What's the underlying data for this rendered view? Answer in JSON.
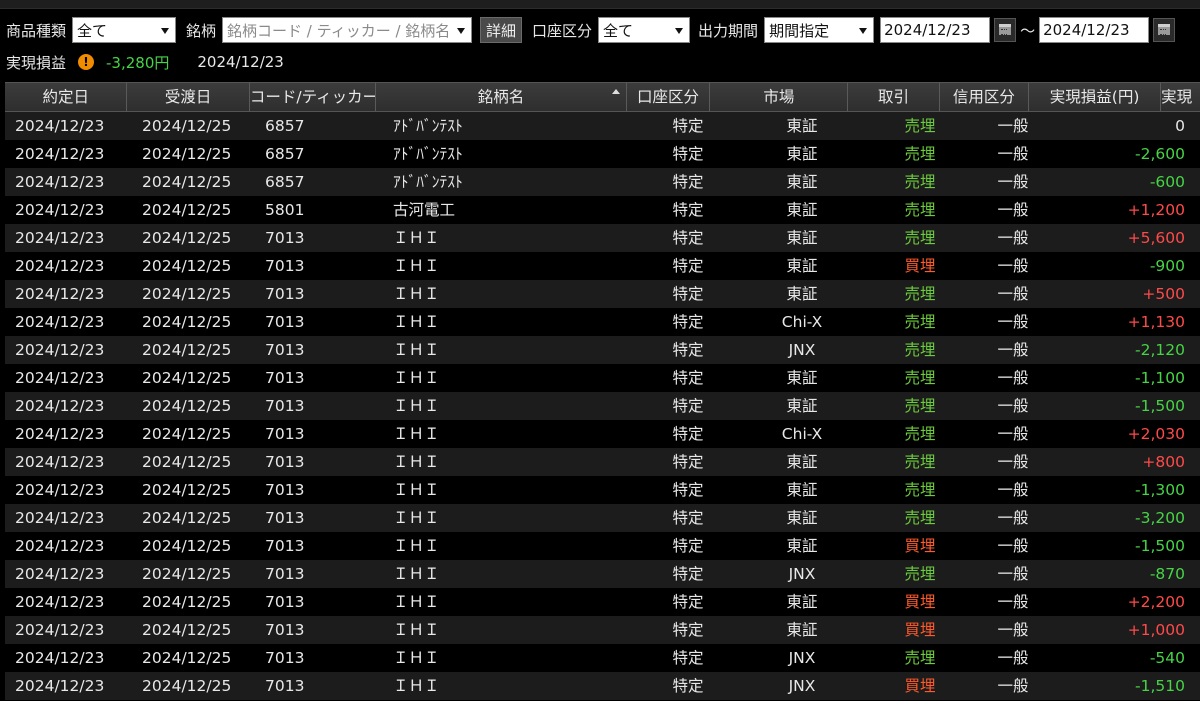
{
  "filters": {
    "product_type_label": "商品種類",
    "product_type_value": "全て",
    "symbol_label": "銘柄",
    "symbol_placeholder": "銘柄コード / ティッカー / 銘柄名",
    "detail_button": "詳細",
    "account_label": "口座区分",
    "account_value": "全て",
    "period_label": "出力期間",
    "period_value": "期間指定",
    "date_from": "2024/12/23",
    "range_sep": "～",
    "date_to": "2024/12/23"
  },
  "summary": {
    "label": "実現損益",
    "warning_icon": "!",
    "total": "-3,280円",
    "date": "2024/12/23"
  },
  "table": {
    "headers": [
      "約定日",
      "受渡日",
      "コード/ティッカー",
      "銘柄名",
      "口座区分",
      "市場",
      "取引",
      "信用区分",
      "実現損益(円)",
      "実現"
    ],
    "rows": [
      [
        "2024/12/23",
        "2024/12/25",
        "6857",
        "ｱﾄﾞﾊﾞﾝﾃｽﾄ",
        "特定",
        "東証",
        "売埋",
        "一般",
        "0"
      ],
      [
        "2024/12/23",
        "2024/12/25",
        "6857",
        "ｱﾄﾞﾊﾞﾝﾃｽﾄ",
        "特定",
        "東証",
        "売埋",
        "一般",
        "-2,600"
      ],
      [
        "2024/12/23",
        "2024/12/25",
        "6857",
        "ｱﾄﾞﾊﾞﾝﾃｽﾄ",
        "特定",
        "東証",
        "売埋",
        "一般",
        "-600"
      ],
      [
        "2024/12/23",
        "2024/12/25",
        "5801",
        "古河電工",
        "特定",
        "東証",
        "売埋",
        "一般",
        "+1,200"
      ],
      [
        "2024/12/23",
        "2024/12/25",
        "7013",
        "ＩＨＩ",
        "特定",
        "東証",
        "売埋",
        "一般",
        "+5,600"
      ],
      [
        "2024/12/23",
        "2024/12/25",
        "7013",
        "ＩＨＩ",
        "特定",
        "東証",
        "買埋",
        "一般",
        "-900"
      ],
      [
        "2024/12/23",
        "2024/12/25",
        "7013",
        "ＩＨＩ",
        "特定",
        "東証",
        "売埋",
        "一般",
        "+500"
      ],
      [
        "2024/12/23",
        "2024/12/25",
        "7013",
        "ＩＨＩ",
        "特定",
        "Chi-X",
        "売埋",
        "一般",
        "+1,130"
      ],
      [
        "2024/12/23",
        "2024/12/25",
        "7013",
        "ＩＨＩ",
        "特定",
        "JNX",
        "売埋",
        "一般",
        "-2,120"
      ],
      [
        "2024/12/23",
        "2024/12/25",
        "7013",
        "ＩＨＩ",
        "特定",
        "東証",
        "売埋",
        "一般",
        "-1,100"
      ],
      [
        "2024/12/23",
        "2024/12/25",
        "7013",
        "ＩＨＩ",
        "特定",
        "東証",
        "売埋",
        "一般",
        "-1,500"
      ],
      [
        "2024/12/23",
        "2024/12/25",
        "7013",
        "ＩＨＩ",
        "特定",
        "Chi-X",
        "売埋",
        "一般",
        "+2,030"
      ],
      [
        "2024/12/23",
        "2024/12/25",
        "7013",
        "ＩＨＩ",
        "特定",
        "東証",
        "売埋",
        "一般",
        "+800"
      ],
      [
        "2024/12/23",
        "2024/12/25",
        "7013",
        "ＩＨＩ",
        "特定",
        "東証",
        "売埋",
        "一般",
        "-1,300"
      ],
      [
        "2024/12/23",
        "2024/12/25",
        "7013",
        "ＩＨＩ",
        "特定",
        "東証",
        "売埋",
        "一般",
        "-3,200"
      ],
      [
        "2024/12/23",
        "2024/12/25",
        "7013",
        "ＩＨＩ",
        "特定",
        "東証",
        "買埋",
        "一般",
        "-1,500"
      ],
      [
        "2024/12/23",
        "2024/12/25",
        "7013",
        "ＩＨＩ",
        "特定",
        "JNX",
        "売埋",
        "一般",
        "-870"
      ],
      [
        "2024/12/23",
        "2024/12/25",
        "7013",
        "ＩＨＩ",
        "特定",
        "東証",
        "買埋",
        "一般",
        "+2,200"
      ],
      [
        "2024/12/23",
        "2024/12/25",
        "7013",
        "ＩＨＩ",
        "特定",
        "東証",
        "買埋",
        "一般",
        "+1,000"
      ],
      [
        "2024/12/23",
        "2024/12/25",
        "7013",
        "ＩＨＩ",
        "特定",
        "JNX",
        "売埋",
        "一般",
        "-540"
      ],
      [
        "2024/12/23",
        "2024/12/25",
        "7013",
        "ＩＨＩ",
        "特定",
        "JNX",
        "買埋",
        "一般",
        "-1,510"
      ]
    ]
  },
  "colors": {
    "negative": "#46d446",
    "positive": "#ff4a4a",
    "sell": "#6ccb3c",
    "buy": "#ff5a2a"
  }
}
